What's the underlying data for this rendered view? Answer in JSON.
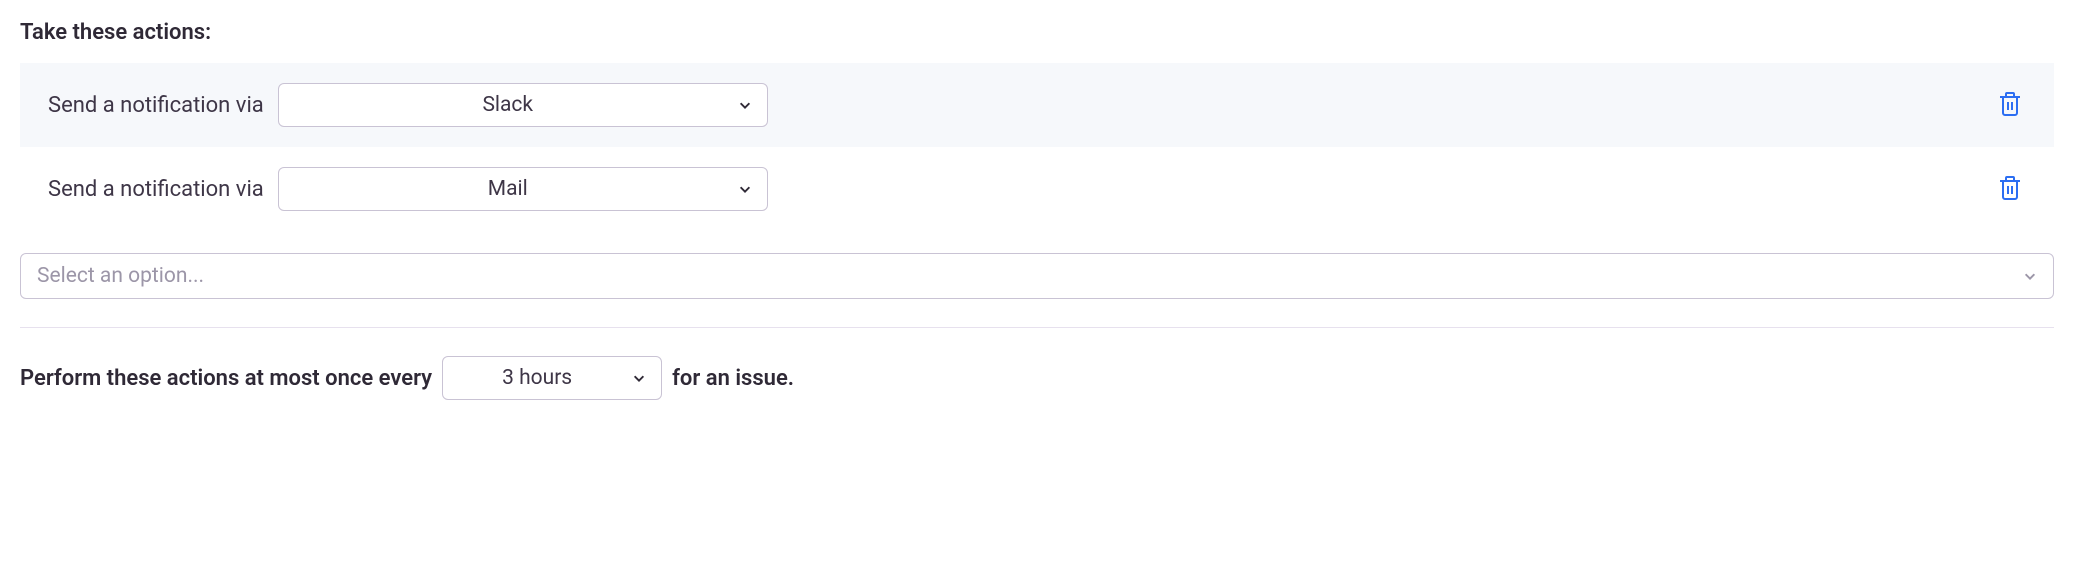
{
  "section_title": "Take these actions:",
  "actions": [
    {
      "label": "Send a notification via",
      "value": "Slack"
    },
    {
      "label": "Send a notification via",
      "value": "Mail"
    }
  ],
  "add_action_placeholder": "Select an option...",
  "frequency": {
    "prefix": "Perform these actions at most once every",
    "value": "3 hours",
    "suffix": "for an issue."
  }
}
